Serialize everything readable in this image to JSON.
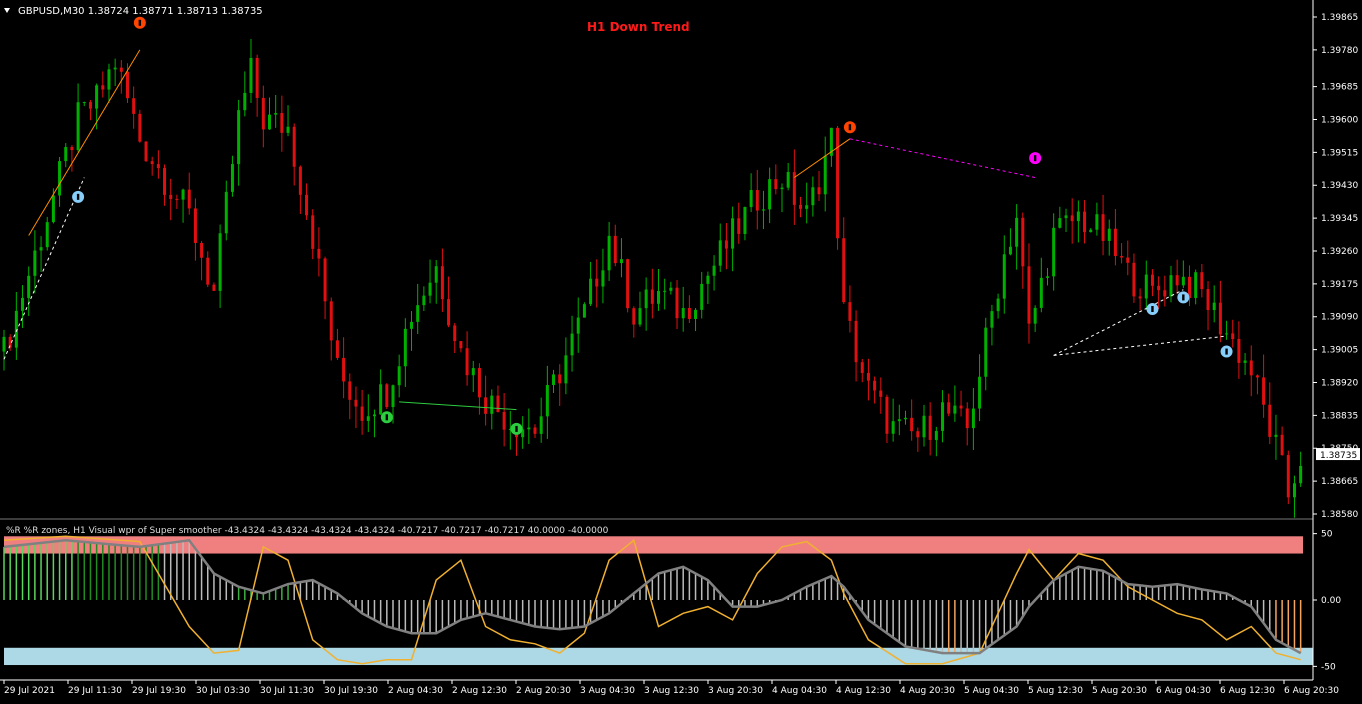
{
  "header": {
    "symbol_label": "GBPUSD,M30  1.38724 1.38771 1.38713 1.38735",
    "trend_label": "H1 Down Trend"
  },
  "indicator_header": "%R   %R zones, H1   Visual wpr of Super smoother  -43.4324 -43.4324 -43.4324 -43.4324 -40.7217 -40.7217 -40.7217 40.0000 -40.0000",
  "colors": {
    "background": "#000000",
    "bull_candle": "#00b000",
    "bear_candle": "#e01010",
    "trend_text": "#ff1a1a",
    "upper_zone": "#f08080",
    "lower_zone": "#add8e6",
    "wpr_line": "#f0b030",
    "smooth_line": "#808080",
    "axis": "#ffffff"
  },
  "chart_data": [
    {
      "type": "candlestick",
      "title": "GBPUSD,M30",
      "ylim": [
        1.3858,
        1.39865
      ],
      "y_ticks": [
        "1.39865",
        "1.39780",
        "1.39685",
        "1.39600",
        "1.39515",
        "1.39430",
        "1.39345",
        "1.39260",
        "1.39175",
        "1.39090",
        "1.39005",
        "1.38920",
        "1.38835",
        "1.38750",
        "1.38665",
        "1.38580"
      ],
      "current_price": "1.38735",
      "x_ticks": [
        "29 Jul 2021",
        "29 Jul 11:30",
        "29 Jul 19:30",
        "30 Jul 03:30",
        "30 Jul 11:30",
        "30 Jul 19:30",
        "2 Aug 04:30",
        "2 Aug 12:30",
        "2 Aug 20:30",
        "3 Aug 04:30",
        "3 Aug 12:30",
        "3 Aug 20:30",
        "4 Aug 04:30",
        "4 Aug 12:30",
        "4 Aug 20:30",
        "5 Aug 04:30",
        "5 Aug 12:30",
        "5 Aug 20:30",
        "6 Aug 04:30",
        "6 Aug 12:30",
        "6 Aug 20:30"
      ],
      "close_path": [
        [
          0,
          1.39
        ],
        [
          4,
          1.392
        ],
        [
          8,
          1.394
        ],
        [
          12,
          1.396
        ],
        [
          15,
          1.3965
        ],
        [
          18,
          1.3975
        ],
        [
          22,
          1.3955
        ],
        [
          26,
          1.3945
        ],
        [
          30,
          1.3935
        ],
        [
          34,
          1.3915
        ],
        [
          38,
          1.396
        ],
        [
          40,
          1.3972
        ],
        [
          42,
          1.396
        ],
        [
          46,
          1.3958
        ],
        [
          50,
          1.393
        ],
        [
          54,
          1.3895
        ],
        [
          58,
          1.3885
        ],
        [
          62,
          1.389
        ],
        [
          66,
          1.391
        ],
        [
          70,
          1.3922
        ],
        [
          74,
          1.39
        ],
        [
          78,
          1.3888
        ],
        [
          82,
          1.3882
        ],
        [
          86,
          1.388
        ],
        [
          90,
          1.3895
        ],
        [
          94,
          1.391
        ],
        [
          98,
          1.393
        ],
        [
          102,
          1.391
        ],
        [
          106,
          1.3915
        ],
        [
          110,
          1.391
        ],
        [
          114,
          1.392
        ],
        [
          118,
          1.393
        ],
        [
          122,
          1.394
        ],
        [
          126,
          1.3945
        ],
        [
          130,
          1.3935
        ],
        [
          134,
          1.3955
        ],
        [
          136,
          1.391
        ],
        [
          140,
          1.389
        ],
        [
          144,
          1.388
        ],
        [
          148,
          1.3878
        ],
        [
          152,
          1.3885
        ],
        [
          156,
          1.388
        ],
        [
          158,
          1.3895
        ],
        [
          162,
          1.3925
        ],
        [
          164,
          1.3935
        ],
        [
          166,
          1.3905
        ],
        [
          170,
          1.393
        ],
        [
          174,
          1.3935
        ],
        [
          178,
          1.393
        ],
        [
          182,
          1.392
        ],
        [
          186,
          1.3915
        ],
        [
          190,
          1.392
        ],
        [
          194,
          1.3915
        ],
        [
          198,
          1.3905
        ],
        [
          202,
          1.3895
        ],
        [
          206,
          1.3875
        ],
        [
          208,
          1.3863
        ],
        [
          210,
          1.3873
        ]
      ],
      "annotations": [
        {
          "label": "U",
          "x": 22,
          "y": 1.3985,
          "color": "#ff4500"
        },
        {
          "label": "U",
          "x": 137,
          "y": 1.3958,
          "color": "#ff4500"
        },
        {
          "label": "U",
          "x": 167,
          "y": 1.395,
          "color": "#ff00ff"
        },
        {
          "label": "A",
          "x": 12,
          "y": 1.394,
          "color": "#87cefa"
        },
        {
          "label": "A",
          "x": 186,
          "y": 1.3911,
          "color": "#87cefa"
        },
        {
          "label": "A",
          "x": 191,
          "y": 1.3914,
          "color": "#87cefa"
        },
        {
          "label": "A",
          "x": 198,
          "y": 1.39,
          "color": "#87cefa"
        },
        {
          "label": "A",
          "x": 62,
          "y": 1.3883,
          "color": "#2ecc40"
        },
        {
          "label": "A",
          "x": 83,
          "y": 1.388,
          "color": "#2ecc40"
        }
      ]
    },
    {
      "type": "line",
      "title": "%R zones, H1 Visual wpr of Super smoother",
      "ylim": [
        -55,
        55
      ],
      "y_ticks": [
        "50",
        "0.00",
        "-50"
      ],
      "zones": [
        40,
        -40
      ],
      "series": [
        {
          "name": "wpr",
          "values": [
            [
              0,
              45
            ],
            [
              10,
              48
            ],
            [
              22,
              44
            ],
            [
              30,
              -20
            ],
            [
              34,
              -40
            ],
            [
              38,
              -38
            ],
            [
              42,
              40
            ],
            [
              46,
              30
            ],
            [
              50,
              -30
            ],
            [
              54,
              -45
            ],
            [
              58,
              -48
            ],
            [
              62,
              -45
            ],
            [
              66,
              -45
            ],
            [
              70,
              15
            ],
            [
              74,
              30
            ],
            [
              78,
              -20
            ],
            [
              82,
              -30
            ],
            [
              86,
              -33
            ],
            [
              90,
              -40
            ],
            [
              94,
              -25
            ],
            [
              98,
              30
            ],
            [
              102,
              45
            ],
            [
              106,
              -20
            ],
            [
              110,
              -10
            ],
            [
              114,
              -5
            ],
            [
              118,
              -15
            ],
            [
              122,
              20
            ],
            [
              126,
              40
            ],
            [
              130,
              44
            ],
            [
              134,
              30
            ],
            [
              136,
              5
            ],
            [
              140,
              -30
            ],
            [
              146,
              -48
            ],
            [
              152,
              -48
            ],
            [
              158,
              -40
            ],
            [
              164,
              20
            ],
            [
              166,
              38
            ],
            [
              170,
              15
            ],
            [
              174,
              35
            ],
            [
              178,
              30
            ],
            [
              182,
              10
            ],
            [
              186,
              0
            ],
            [
              190,
              -10
            ],
            [
              194,
              -15
            ],
            [
              198,
              -30
            ],
            [
              202,
              -20
            ],
            [
              206,
              -40
            ],
            [
              210,
              -45
            ]
          ]
        },
        {
          "name": "smooth",
          "values": [
            [
              0,
              40
            ],
            [
              10,
              45
            ],
            [
              22,
              40
            ],
            [
              30,
              45
            ],
            [
              34,
              20
            ],
            [
              38,
              10
            ],
            [
              42,
              5
            ],
            [
              46,
              12
            ],
            [
              50,
              15
            ],
            [
              54,
              5
            ],
            [
              58,
              -10
            ],
            [
              62,
              -20
            ],
            [
              66,
              -25
            ],
            [
              70,
              -25
            ],
            [
              74,
              -15
            ],
            [
              78,
              -10
            ],
            [
              82,
              -15
            ],
            [
              86,
              -20
            ],
            [
              90,
              -22
            ],
            [
              94,
              -20
            ],
            [
              98,
              -10
            ],
            [
              102,
              5
            ],
            [
              106,
              20
            ],
            [
              110,
              25
            ],
            [
              114,
              15
            ],
            [
              118,
              -5
            ],
            [
              122,
              -5
            ],
            [
              126,
              0
            ],
            [
              130,
              10
            ],
            [
              134,
              18
            ],
            [
              136,
              10
            ],
            [
              140,
              -15
            ],
            [
              146,
              -35
            ],
            [
              152,
              -40
            ],
            [
              158,
              -40
            ],
            [
              164,
              -20
            ],
            [
              166,
              -5
            ],
            [
              170,
              15
            ],
            [
              174,
              25
            ],
            [
              178,
              22
            ],
            [
              182,
              12
            ],
            [
              186,
              10
            ],
            [
              190,
              12
            ],
            [
              194,
              8
            ],
            [
              198,
              5
            ],
            [
              202,
              -5
            ],
            [
              206,
              -30
            ],
            [
              210,
              -40
            ]
          ]
        }
      ],
      "x_ticks": [
        "29 Jul 2021",
        "29 Jul 11:30",
        "29 Jul 19:30",
        "30 Jul 03:30",
        "30 Jul 11:30",
        "30 Jul 19:30",
        "2 Aug 04:30",
        "2 Aug 12:30",
        "2 Aug 20:30",
        "3 Aug 04:30",
        "3 Aug 12:30",
        "3 Aug 20:30",
        "4 Aug 04:30",
        "4 Aug 12:30",
        "4 Aug 20:30",
        "5 Aug 04:30",
        "5 Aug 12:30",
        "5 Aug 20:30",
        "6 Aug 04:30",
        "6 Aug 12:30",
        "6 Aug 20:30"
      ]
    }
  ]
}
